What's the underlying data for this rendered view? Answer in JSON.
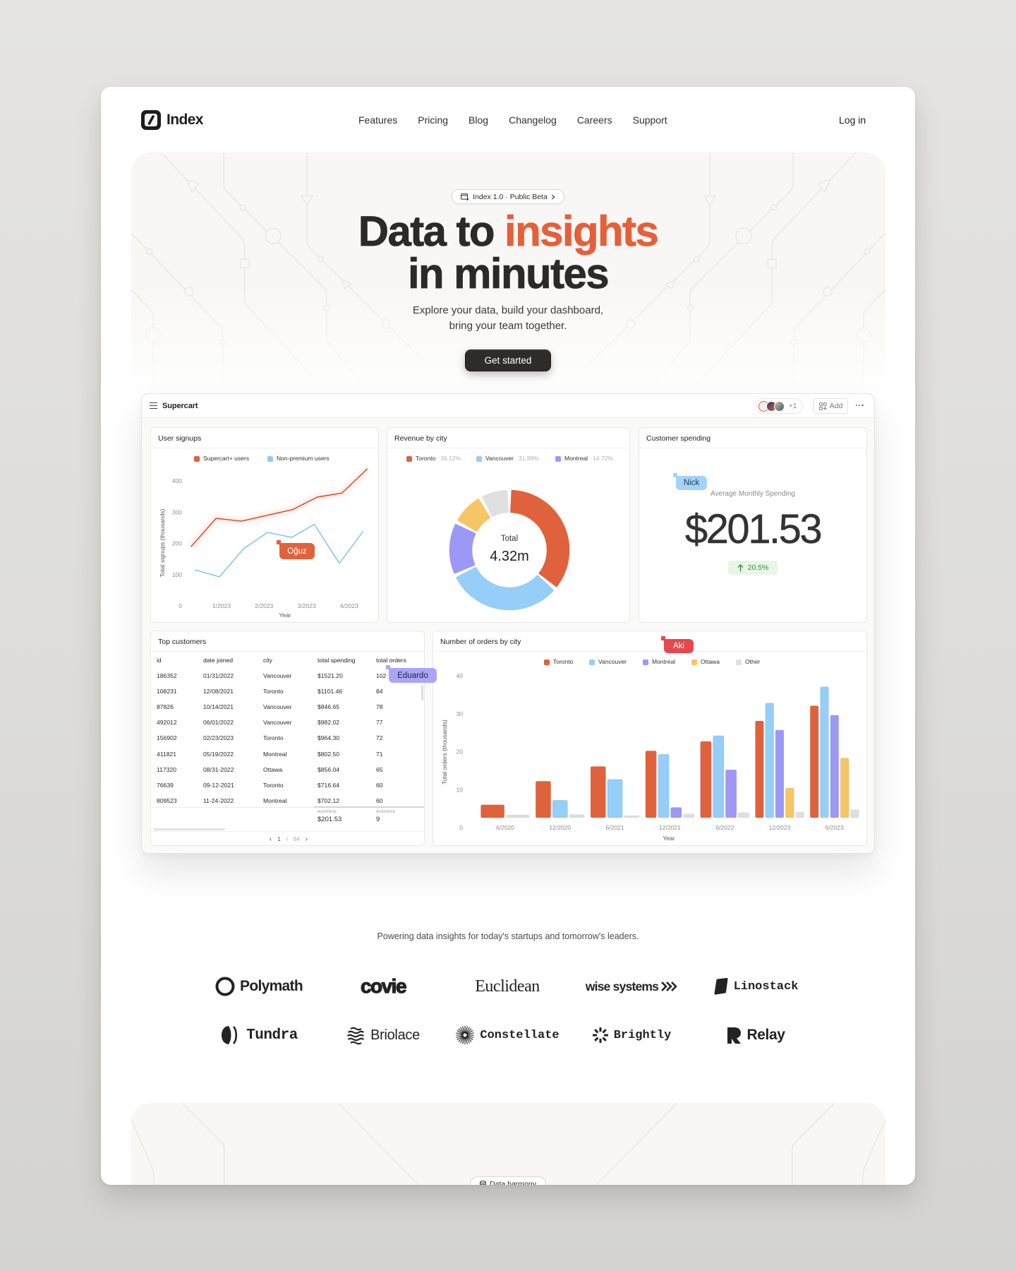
{
  "nav": {
    "brand": "Index",
    "links": [
      "Features",
      "Pricing",
      "Blog",
      "Changelog",
      "Careers",
      "Support"
    ],
    "login": "Log in"
  },
  "hero": {
    "badge": "Index 1.0 · Public Beta",
    "headline_lead": "Data to",
    "headline_accent": "insights",
    "headline_line2": "in minutes",
    "subtitle": [
      "Explore your data, build your dashboard,",
      "bring your team together."
    ],
    "cta": "Get started"
  },
  "colors": {
    "text": "#2b2a28",
    "accent": "#e5603a",
    "cta_background": "#2f2b28",
    "positive": "#2e8b3a",
    "positive_background": "#e9f6e6"
  },
  "dashboard": {
    "title": "Supercart",
    "collaborators_extra": "+1",
    "add_label": "Add",
    "cursors": [
      {
        "name": "Oğuz",
        "color": "#e0623c",
        "text_color": "#ffffff"
      },
      {
        "name": "Nick",
        "color": "#a3d4f7",
        "text_color": "#1d3a52"
      },
      {
        "name": "Eduardo",
        "color": "#aaa6f6",
        "text_color": "#1f1c4d"
      },
      {
        "name": "Aki",
        "color": "#e5484d",
        "text_color": "#ffffff"
      }
    ],
    "spending": {
      "title": "Customer spending",
      "label": "Average Monthly Spending",
      "value": "$201.53",
      "change": "20.5%",
      "trend": "up"
    },
    "customers": {
      "title": "Top customers",
      "columns": [
        "id",
        "date joined",
        "city",
        "total spending",
        "total orders"
      ],
      "rows": [
        [
          "186352",
          "01/31/2022",
          "Vancouver",
          "$1521.20",
          "102"
        ],
        [
          "108231",
          "12/08/2021",
          "Toronto",
          "$1101.46",
          "84"
        ],
        [
          "87826",
          "10/14/2021",
          "Vancouver",
          "$846.65",
          "78"
        ],
        [
          "492012",
          "06/01/2022",
          "Vancouver",
          "$982.02",
          "77"
        ],
        [
          "156902",
          "02/23/2023",
          "Toronto",
          "$964.30",
          "72"
        ],
        [
          "411821",
          "05/19/2022",
          "Montreal",
          "$802.50",
          "71"
        ],
        [
          "117320",
          "08/31-2022",
          "Ottawa",
          "$856.04",
          "65"
        ],
        [
          "76639",
          "09-12-2021",
          "Toronto",
          "$716.64",
          "60"
        ],
        [
          "809523",
          "11-24-2022",
          "Montreal",
          "$702.12",
          "60"
        ]
      ],
      "footer": {
        "spending_label": "AVERAGE",
        "spending_value": "$201.53",
        "orders_label": "AVERAGE",
        "orders_value": "9"
      },
      "pagination": {
        "page": "1",
        "separator": "/",
        "total": "64"
      }
    }
  },
  "logos": {
    "tagline": "Powering data insights for today's startups and tomorrow's leaders.",
    "items": [
      "Polymath",
      "covie",
      "Euclidean",
      "wise systems",
      "Linostack",
      "Tundra",
      "Briolace",
      "Constellate",
      "Brightly",
      "Relay"
    ]
  },
  "next_section": {
    "badge": "Data harmony"
  },
  "chart_data": [
    {
      "type": "line",
      "title": "User signups",
      "xlabel": "Year",
      "ylabel": "Total signups (thousands)",
      "xticks": [
        {
          "label": "1/2023",
          "x": 1
        },
        {
          "label": "2/2023",
          "x": 2
        },
        {
          "label": "3/2023",
          "x": 3
        },
        {
          "label": "4/2023",
          "x": 4
        }
      ],
      "xlim": [
        0.2,
        4.6
      ],
      "ylim": [
        0,
        450
      ],
      "yticks": [
        0,
        100,
        200,
        300,
        400
      ],
      "grid": false,
      "legend": "top",
      "series": [
        {
          "name": "Supercart+ users",
          "color": "#e0623c",
          "line_color": "#cf4a24",
          "x": [
            0.28,
            0.87,
            1.47,
            2.08,
            2.67,
            3.25,
            3.83,
            4.43
          ],
          "y": [
            189,
            280,
            271,
            290,
            308,
            348,
            361,
            439
          ]
        },
        {
          "name": "Non-premium users",
          "color": "#8ecbf6",
          "line_color": "#78bff0",
          "x": [
            0.38,
            0.95,
            1.52,
            2.08,
            2.65,
            3.18,
            3.77,
            4.33
          ],
          "y": [
            115,
            93,
            183,
            235,
            219,
            261,
            136,
            239
          ]
        }
      ]
    },
    {
      "type": "pie",
      "variant": "donut",
      "title": "Revenue by city",
      "center_label": "Total",
      "center_value": "4.32m",
      "legend": "top",
      "legend_values": [
        "36.12%",
        "31.89%",
        "14.72%"
      ],
      "slices": [
        {
          "label": "Toronto",
          "value": 36.12,
          "color": "#e0623c"
        },
        {
          "label": "Vancouver",
          "value": 31.89,
          "color": "#94cef9"
        },
        {
          "label": "Montreal",
          "value": 14.72,
          "color": "#9d98f6"
        },
        {
          "label": "Ottawa",
          "value": 9.2,
          "color": "#f6c566"
        },
        {
          "label": "Other",
          "value": 8.07,
          "color": "#e0e0e0"
        }
      ]
    },
    {
      "type": "bar",
      "title": "Number of orders by city",
      "xlabel": "Year",
      "ylabel": "Total orders (thousands)",
      "categories": [
        "6/2020",
        "12/2020",
        "6/2021",
        "12/2021",
        "6/2022",
        "12/2023",
        "6/2023"
      ],
      "ylim": [
        0,
        40
      ],
      "yticks": [
        0,
        10,
        20,
        30,
        40
      ],
      "grid": false,
      "legend": "top",
      "series": [
        {
          "name": "Toronto",
          "color": "#e0623c",
          "values": [
            6.0,
            12.2,
            16.1,
            20.2,
            22.7,
            28.1,
            32.1
          ]
        },
        {
          "name": "Vancouver",
          "color": "#94cef9",
          "values": [
            null,
            7.2,
            12.7,
            19.3,
            24.2,
            32.8,
            37.1
          ]
        },
        {
          "name": "Montreal",
          "color": "#9d98f6",
          "values": [
            null,
            null,
            null,
            5.3,
            15.2,
            25.7,
            29.6
          ]
        },
        {
          "name": "Ottawa",
          "color": "#f6c566",
          "values": [
            null,
            null,
            null,
            null,
            null,
            10.4,
            18.3
          ]
        },
        {
          "name": "Other",
          "color": "#dfdfdf",
          "values": [
            3.3,
            3.4,
            3.1,
            3.6,
            3.9,
            4.1,
            4.7
          ]
        }
      ]
    }
  ]
}
